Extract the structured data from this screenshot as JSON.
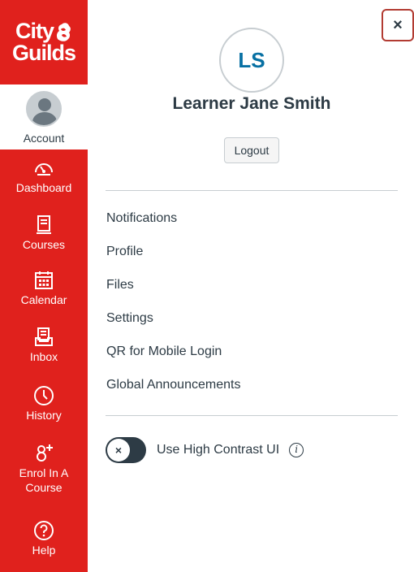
{
  "brand": {
    "logo_line1": "City",
    "logo_line2": "Guilds",
    "nav_color": "#e0211d"
  },
  "global_nav": {
    "account_label": "Account",
    "items": [
      {
        "label": "Dashboard",
        "icon": "dashboard-icon"
      },
      {
        "label": "Courses",
        "icon": "courses-icon"
      },
      {
        "label": "Calendar",
        "icon": "calendar-icon"
      },
      {
        "label": "Inbox",
        "icon": "inbox-icon"
      },
      {
        "label": "History",
        "icon": "history-icon"
      },
      {
        "label": "Enrol In A",
        "label2": "Course",
        "icon": "enrol-icon"
      },
      {
        "label": "Help",
        "icon": "help-icon"
      }
    ]
  },
  "tray": {
    "close_label": "×",
    "avatar_initials": "LS",
    "user_name": "Learner Jane Smith",
    "logout_label": "Logout",
    "menu": [
      {
        "label": "Notifications"
      },
      {
        "label": "Profile"
      },
      {
        "label": "Files"
      },
      {
        "label": "Settings"
      },
      {
        "label": "QR for Mobile Login"
      },
      {
        "label": "Global Announcements"
      }
    ],
    "high_contrast": {
      "label": "Use High Contrast UI",
      "toggle_glyph": "×",
      "enabled": false,
      "info_glyph": "i"
    }
  }
}
